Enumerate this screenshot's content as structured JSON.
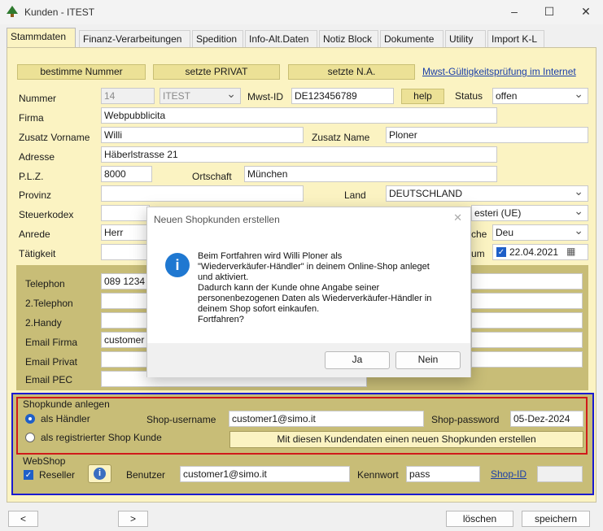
{
  "window": {
    "title": "Kunden - ITEST",
    "min": "–",
    "max": "☐",
    "close": "✕"
  },
  "tabs": [
    "Stammdaten",
    "Finanz-Verarbeitungen",
    "Spedition",
    "Info-Alt.Daten",
    "Notiz Block",
    "Dokumente",
    "Utility",
    "Import K-L"
  ],
  "toolbar": {
    "btn_number": "bestimme Nummer",
    "btn_private": "setzte PRIVAT",
    "btn_na": "setzte N.A.",
    "link_vat": "Mwst-Gültigkeitsprüfung im Internet"
  },
  "form": {
    "nummer_label": "Nummer",
    "nummer_value": "14",
    "company_code": "ITEST",
    "mwst_label": "Mwst-ID",
    "mwst_value": "DE123456789",
    "help_label": "help",
    "status_label": "Status",
    "status_value": "offen",
    "firma_label": "Firma",
    "firma_value": "Webpubblicita",
    "vorname_label": "Zusatz Vorname",
    "vorname_value": "Willi",
    "name_label": "Zusatz Name",
    "name_value": "Ploner",
    "adresse_label": "Adresse",
    "adresse_value": "Häberlstrasse 21",
    "plz_label": "P.L.Z.",
    "plz_value": "8000",
    "ort_label": "Ortschaft",
    "ort_value": "München",
    "provinz_label": "Provinz",
    "provinz_value": "",
    "land_label": "Land",
    "land_value": "DEUTSCHLAND",
    "steuer_label": "Steuerkodex",
    "steuer_value": "",
    "steuer_sel": "esteri (UE)",
    "anrede_label": "Anrede",
    "anrede_value": "Herr",
    "sprache_label": "che",
    "sprache_value": "Deu",
    "taetig_label": "Tätigkeit",
    "taetig_value": "",
    "datum_label": "um",
    "datum_value": "22.04.2021"
  },
  "contact": {
    "tel_label": "Telephon",
    "tel_value": "089 1234",
    "tel2_label": "2.Telephon",
    "handy_label": "2.Handy",
    "email_firma_label": "Email Firma",
    "email_firma_value": "customer",
    "email_privat_label": "Email Privat",
    "email_pec_label": "Email PEC"
  },
  "shop": {
    "legend": "Shopkunde anlegen",
    "radio_dealer": "als Händler",
    "radio_registered": "als registrierter Shop Kunde",
    "username_label": "Shop-username",
    "username_value": "customer1@simo.it",
    "password_label": "Shop-password",
    "password_value": "05-Dez-2024",
    "create_button": "Mit diesen Kundendaten einen neuen Shopkunden erstellen"
  },
  "webshop": {
    "legend": "WebShop",
    "reseller_label": "Reseller",
    "info_glyph": "i",
    "benutzer_label": "Benutzer",
    "benutzer_value": "customer1@simo.it",
    "kennwort_label": "Kennwort",
    "kennwort_value": "pass",
    "shopid_link": "Shop-ID",
    "shopid_value": ""
  },
  "bottom": {
    "prev": "<",
    "next": ">",
    "delete": "löschen",
    "save": "speichern"
  },
  "dialog": {
    "title": "Neuen Shopkunden erstellen",
    "close": "✕",
    "icon": "i",
    "message": "Beim Fortfahren wird Willi Ploner als\n\"Wiederverkäufer-Händler\" in deinem Online-Shop anleget\nund aktiviert.\nDadurch kann der Kunde ohne Angabe seiner\npersonenbezogenen Daten als Wiederverkäufer-Händler in\ndeinem Shop sofort einkaufen.\nFortfahren?",
    "yes": "Ja",
    "no": "Nein"
  },
  "colors": {
    "panel": "#fbf3c2",
    "section": "#c8bd77",
    "button_yellow": "#ece196",
    "accent": "#1e5fc8",
    "red_frame": "#d01a1a",
    "blue_frame": "#1a1ad0"
  }
}
